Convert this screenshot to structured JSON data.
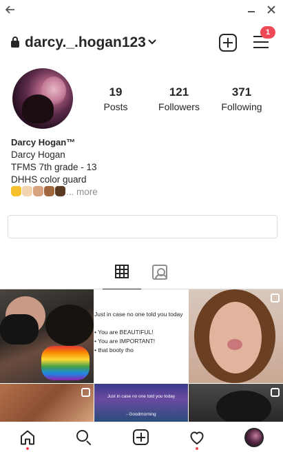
{
  "header": {
    "username": "darcy._.hogan123",
    "notification_count": "1"
  },
  "profile": {
    "stats": [
      {
        "value": "19",
        "label": "Posts"
      },
      {
        "value": "121",
        "label": "Followers"
      },
      {
        "value": "371",
        "label": "Following"
      }
    ],
    "bio": {
      "display_name": "Darcy Hogan™",
      "lines": [
        "Darcy Hogan",
        "TFMS 7th grade - 13",
        "DHHS color guard"
      ],
      "emoji_colors": [
        "#f5c12c",
        "#f3d3b0",
        "#d7a27e",
        "#a0673f",
        "#5c3b24"
      ],
      "more": "... more"
    }
  },
  "posts": {
    "text_post": {
      "lines": [
        "Just in case no one told you today",
        "",
        "• You are BEAUTIFUL!",
        "• You are IMPORTANT!",
        "• that booty tho"
      ]
    },
    "video_post": {
      "top": "Just in case no one told you today",
      "bottom": "- Goodmorning"
    }
  },
  "colors": {
    "accent": "#ed4956",
    "text": "#262626",
    "muted": "#8e8e8e",
    "divider": "#dbdbdb"
  }
}
